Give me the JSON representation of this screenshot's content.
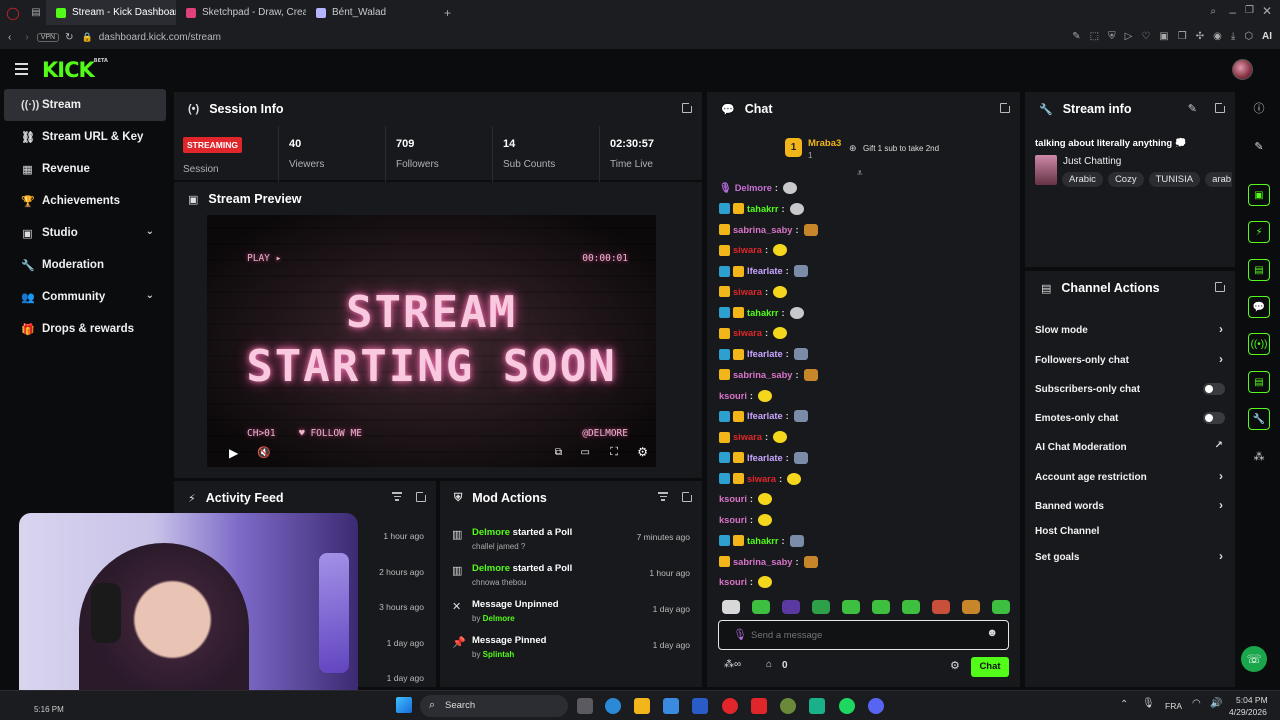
{
  "browser": {
    "tabs": [
      {
        "label": "Stream - Kick Dashboard",
        "color": "#53fc18",
        "active": true
      },
      {
        "label": "Sketchpad - Draw, Create",
        "color": "#e0417a",
        "active": false
      },
      {
        "label": "Bént_Walad",
        "color": "#b4b4ff",
        "active": false
      }
    ],
    "url": "dashboard.kick.com/stream",
    "vpn": "VPN",
    "ai": "AI"
  },
  "brand": {
    "logo": "KICK",
    "beta": "BETA",
    "accent": "#53fc18"
  },
  "sidebar": {
    "items": [
      {
        "label": "Stream",
        "icon": "broadcast-icon",
        "glyph": "((·))",
        "active": true,
        "chev": false
      },
      {
        "label": "Stream URL & Key",
        "icon": "link-icon",
        "glyph": "⛓",
        "active": false,
        "chev": false
      },
      {
        "label": "Revenue",
        "icon": "chart-icon",
        "glyph": "▦",
        "active": false,
        "chev": false
      },
      {
        "label": "Achievements",
        "icon": "trophy-icon",
        "glyph": "🏆",
        "active": false,
        "chev": false
      },
      {
        "label": "Studio",
        "icon": "studio-icon",
        "glyph": "▣",
        "active": false,
        "chev": true
      },
      {
        "label": "Moderation",
        "icon": "wrench-icon",
        "glyph": "🔧",
        "active": false,
        "chev": false
      },
      {
        "label": "Community",
        "icon": "community-icon",
        "glyph": "👥",
        "active": false,
        "chev": true
      },
      {
        "label": "Drops & rewards",
        "icon": "gift-icon",
        "glyph": "🎁",
        "active": false,
        "chev": false
      }
    ]
  },
  "session": {
    "title": "Session Info",
    "status": "STREAMING",
    "status_label": "Session",
    "stats": [
      {
        "value": "40",
        "label": "Viewers"
      },
      {
        "value": "709",
        "label": "Followers"
      },
      {
        "value": "14",
        "label": "Sub Counts"
      },
      {
        "value": "02:30:57",
        "label": "Time Live"
      }
    ]
  },
  "preview": {
    "title": "Stream Preview",
    "play": "PLAY ▸",
    "timer": "00:00:01",
    "line1": "STREAM",
    "line2": "STARTING SOON",
    "channel": "CH>01",
    "follow": "♥ FOLLOW ME",
    "handle": "@DELMORE"
  },
  "activity": {
    "title": "Activity Feed",
    "times": [
      "1 hour ago",
      "2 hours ago",
      "3 hours ago",
      "1 day ago",
      "1 day ago"
    ]
  },
  "mod_actions": {
    "title": "Mod Actions",
    "items": [
      {
        "user": "Delmore",
        "action": " started a Poll",
        "sub": "challel jamed ?",
        "sub_user": "",
        "time": "7 minutes ago",
        "icon": "poll-icon",
        "glyph": "▥"
      },
      {
        "user": "Delmore",
        "action": " started a Poll",
        "sub": "chnowa thebou",
        "sub_user": "",
        "time": "1 hour ago",
        "icon": "poll-icon",
        "glyph": "▥"
      },
      {
        "user": "",
        "action": "Message Unpinned",
        "sub": "by ",
        "sub_user": "Delmore",
        "time": "1 day ago",
        "icon": "unpin-icon",
        "glyph": "✕"
      },
      {
        "user": "",
        "action": "Message Pinned",
        "sub": "by ",
        "sub_user": "Splintah",
        "time": "1 day ago",
        "icon": "pin-icon",
        "glyph": "📌"
      }
    ]
  },
  "chat": {
    "title": "Chat",
    "pinned_user": "Mraba3",
    "pinned_rank": "1",
    "pinned_count": "1",
    "gift_text": "Gift 1 sub to take 2nd",
    "messages": [
      {
        "user": "Delmore",
        "color": "#c96fd7",
        "badges": [
          "mic"
        ],
        "emote": "em-grey"
      },
      {
        "user": "tahakrr",
        "color": "#53fc18",
        "badges": [
          "blue",
          "gold"
        ],
        "emote": "em-grey"
      },
      {
        "user": "sabrina_saby",
        "color": "#d874c8",
        "badges": [
          "gold"
        ],
        "emote": "em-cart"
      },
      {
        "user": "siwara",
        "color": "#e0262b",
        "badges": [
          "gold"
        ],
        "emote": "em-yellow"
      },
      {
        "user": "lfearlate",
        "color": "#c9a6ff",
        "badges": [
          "blue",
          "gold"
        ],
        "emote": "em-blue"
      },
      {
        "user": "siwara",
        "color": "#e0262b",
        "badges": [
          "gold"
        ],
        "emote": "em-yellow"
      },
      {
        "user": "tahakrr",
        "color": "#53fc18",
        "badges": [
          "blue",
          "gold"
        ],
        "emote": "em-grey"
      },
      {
        "user": "siwara",
        "color": "#e0262b",
        "badges": [
          "gold"
        ],
        "emote": "em-yellow"
      },
      {
        "user": "lfearlate",
        "color": "#c9a6ff",
        "badges": [
          "blue",
          "gold"
        ],
        "emote": "em-blue"
      },
      {
        "user": "sabrina_saby",
        "color": "#d874c8",
        "badges": [
          "gold"
        ],
        "emote": "em-cart"
      },
      {
        "user": "ksouri",
        "color": "#d874c8",
        "badges": [],
        "emote": "em-yellow"
      },
      {
        "user": "lfearlate",
        "color": "#c9a6ff",
        "badges": [
          "blue",
          "gold"
        ],
        "emote": "em-blue"
      },
      {
        "user": "siwara",
        "color": "#e0262b",
        "badges": [
          "gold"
        ],
        "emote": "em-yellow"
      },
      {
        "user": "lfearlate",
        "color": "#c9a6ff",
        "badges": [
          "blue",
          "gold"
        ],
        "emote": "em-blue"
      },
      {
        "user": "siwara",
        "color": "#e0262b",
        "badges": [
          "blue",
          "gold"
        ],
        "emote": "em-yellow"
      },
      {
        "user": "ksouri",
        "color": "#d874c8",
        "badges": [],
        "emote": "em-yellow"
      },
      {
        "user": "ksouri",
        "color": "#d874c8",
        "badges": [],
        "emote": "em-yellow"
      },
      {
        "user": "tahakrr",
        "color": "#53fc18",
        "badges": [
          "blue",
          "gold"
        ],
        "emote": "em-blue"
      },
      {
        "user": "sabrina_saby",
        "color": "#d874c8",
        "badges": [
          "gold"
        ],
        "emote": "em-cart"
      },
      {
        "user": "ksouri",
        "color": "#d874c8",
        "badges": [],
        "emote": "em-yellow"
      }
    ],
    "emoji_colors": [
      "#d8d8d8",
      "#3fbf3f",
      "#5a3aa0",
      "#2ea04a",
      "#3fbf3f",
      "#3fbf3f",
      "#3fbf3f",
      "#c8503a",
      "#c8862a",
      "#3fbf3f"
    ],
    "placeholder": "Send a message",
    "points": "0",
    "send_label": "Chat"
  },
  "stream_info": {
    "title": "Stream info",
    "stream_title": "talking about literally anything 💭",
    "category": "Just Chatting",
    "tags": [
      "Arabic",
      "Cozy",
      "TUNISIA",
      "arab"
    ]
  },
  "channel_actions": {
    "title": "Channel Actions",
    "items": [
      {
        "label": "Slow mode",
        "control": "arrow"
      },
      {
        "label": "Followers-only chat",
        "control": "arrow"
      },
      {
        "label": "Subscribers-only chat",
        "control": "toggle"
      },
      {
        "label": "Emotes-only chat",
        "control": "toggle"
      },
      {
        "label": "AI Chat Moderation",
        "control": "external"
      },
      {
        "label": "Account age restriction",
        "control": "arrow"
      },
      {
        "label": "Banned words",
        "control": "arrow"
      },
      {
        "label": "Host Channel",
        "control": "none"
      },
      {
        "label": "Set goals",
        "control": "arrow"
      }
    ]
  },
  "taskbar": {
    "search": "Search",
    "lang": "FRA",
    "time": "5:04 PM",
    "date": "4/29/2026",
    "left_time": "5:16 PM"
  }
}
